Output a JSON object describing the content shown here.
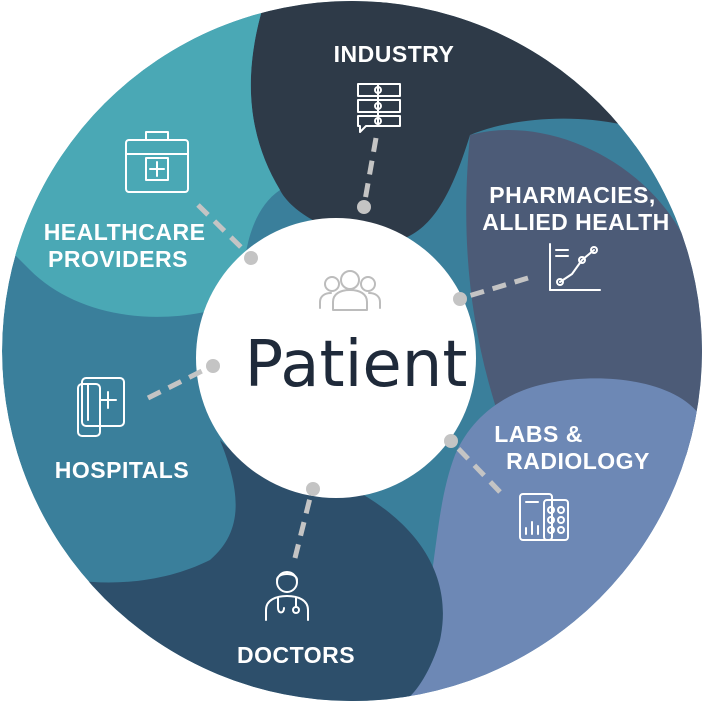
{
  "center": {
    "label": "Patient",
    "icon": "people-group-icon"
  },
  "segments": [
    {
      "id": "industry",
      "lines": [
        "INDUSTRY"
      ],
      "icon": "document-flow-icon",
      "color": "#2e3a48"
    },
    {
      "id": "pharmacies",
      "lines": [
        "PHARMACIES,",
        "ALLIED HEALTH"
      ],
      "icon": "chart-trend-icon",
      "color": "#4c5b77"
    },
    {
      "id": "labs",
      "lines": [
        "LABS &",
        "RADIOLOGY"
      ],
      "icon": "lab-report-icon",
      "color": "#6d88b5"
    },
    {
      "id": "doctors",
      "lines": [
        "DOCTORS"
      ],
      "icon": "doctor-icon",
      "color": "#2d4f6b"
    },
    {
      "id": "hospitals",
      "lines": [
        "HOSPITALS"
      ],
      "icon": "hospital-icon",
      "color": "#3a7f9b"
    },
    {
      "id": "healthcare",
      "lines": [
        "HEALTHCARE",
        "PROVIDERS"
      ],
      "icon": "medical-kit-icon",
      "color": "#4aa8b5"
    }
  ]
}
